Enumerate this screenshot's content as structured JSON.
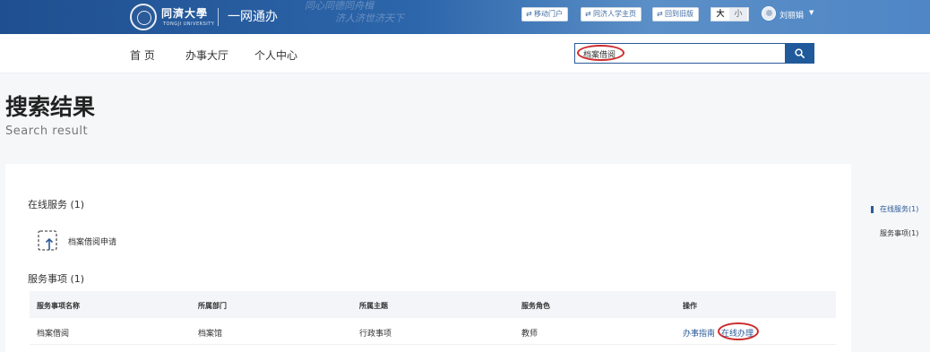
{
  "header": {
    "logo_name": "同濟大學",
    "logo_sub": "TONGJI UNIVERSITY",
    "site_name": "一网通办",
    "slogan_line1": "同心同德同舟楫",
    "slogan_line2": "济人济世济天下",
    "links": [
      {
        "label": "移动门户",
        "icon": "link-icon"
      },
      {
        "label": "同济人学主页",
        "icon": "link-icon"
      },
      {
        "label": "回到旧版",
        "icon": "link-icon"
      }
    ],
    "font_size": {
      "large": "大",
      "small": "小",
      "selected": "大"
    },
    "user_name": "刘丽娟"
  },
  "nav": {
    "items": [
      "首 页",
      "办事大厅",
      "个人中心"
    ],
    "search_value": "档案借阅"
  },
  "page": {
    "title": "搜索结果",
    "subtitle": "Search result"
  },
  "online_services": {
    "heading": "在线服务 (1)",
    "items": [
      {
        "label": "档案借阅申请",
        "icon": "apply-upload-icon"
      }
    ]
  },
  "service_items": {
    "heading": "服务事项 (1)",
    "columns": [
      "服务事项名称",
      "所属部门",
      "所属主题",
      "服务角色",
      "操作"
    ],
    "rows": [
      {
        "name": "档案借阅",
        "department": "档案馆",
        "theme": "行政事项",
        "role": "教师",
        "actions": [
          "办事指南",
          "在线办理"
        ]
      }
    ]
  },
  "side_nav": {
    "items": [
      "在线服务(1)",
      "服务事项(1)"
    ],
    "active": "在线服务(1)"
  },
  "colors": {
    "primary": "#215a9b",
    "annotation": "#cc2d2d"
  }
}
